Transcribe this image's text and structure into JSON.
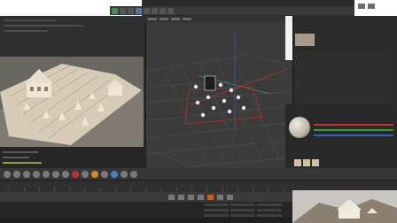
{
  "app": {
    "top_toolbar_icons": [
      "move-icon",
      "scale-icon",
      "rotate-icon",
      "select-icon",
      "render-icon",
      "render-settings-icon",
      "object-icon",
      "spline-icon"
    ],
    "accent_green": "#3f8f56",
    "accent_blue": "#4a78b0"
  },
  "viewport": {
    "grid_color": "#555555",
    "axis_colors": {
      "x": "#c04040",
      "y": "#40c060",
      "z": "#4060c0"
    },
    "selection_color": "#b03030"
  },
  "timeline": {
    "frame_labels": [
      "0",
      "5",
      "10",
      "15",
      "20",
      "25",
      "30",
      "35",
      "40",
      "45",
      "50",
      "55",
      "60",
      "65",
      "70",
      "75",
      "80",
      "85",
      "90"
    ],
    "record_color": "#d05a20"
  },
  "material": {
    "preview_colors": [
      "#f0ede6",
      "#bdb4a6",
      "#6e675e"
    ],
    "swatch_color": "#cfc0a8",
    "channel_colors": [
      "#c83030",
      "#30a030",
      "#3060c0"
    ]
  },
  "preview_render": {
    "background": "#6e6a63",
    "model_color": "#d9cfbe"
  }
}
